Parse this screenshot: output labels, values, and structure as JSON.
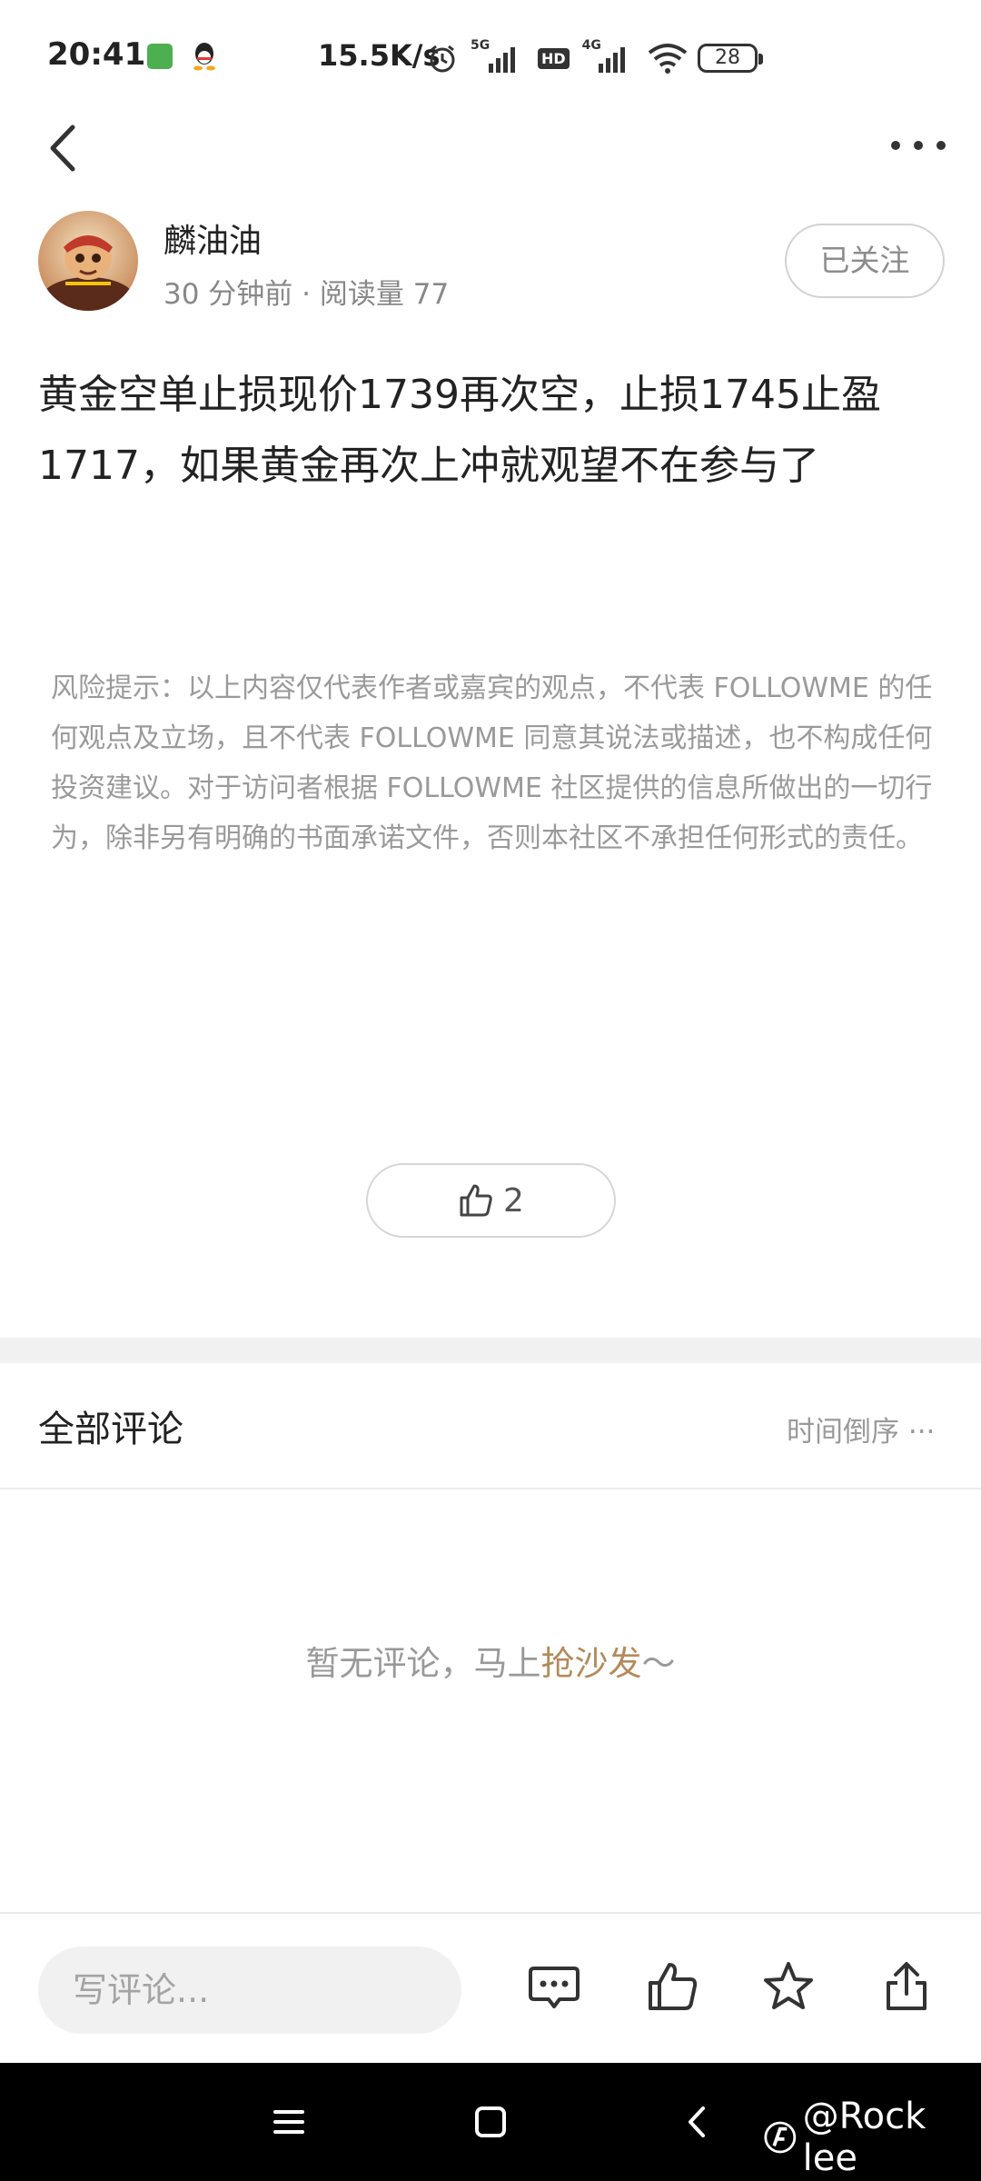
{
  "status_bar": {
    "time": "20:41",
    "net_speed": "15.5K/s",
    "sim1_tag": "5G",
    "hd_tag": "HD",
    "sim2_tag": "4G",
    "battery": "28"
  },
  "author": {
    "name": "麟油油",
    "meta": "30 分钟前 · 阅读量 77",
    "follow_label": "已关注"
  },
  "article": {
    "body": "黄金空单止损现价1739再次空，止损1745止盈1717，如果黄金再次上冲就观望不在参与了"
  },
  "disclaimer": "风险提示：以上内容仅代表作者或嘉宾的观点，不代表 FOLLOWME 的任何观点及立场，且不代表 FOLLOWME 同意其说法或描述，也不构成任何投资建议。对于访问者根据 FOLLOWME 社区提供的信息所做出的一切行为，除非另有明确的书面承诺文件，否则本社区不承担任何形式的责任。",
  "like": {
    "count": "2"
  },
  "comments": {
    "title": "全部评论",
    "sort_label": "时间倒序 ···",
    "empty_prefix": "暂无评论，马上",
    "empty_link": "抢沙发",
    "empty_suffix": "～"
  },
  "bottom_bar": {
    "input_placeholder": "写评论..."
  },
  "watermark": {
    "text": "@Rock lee"
  },
  "colors": {
    "accent_link": "#b48a5a",
    "separator": "#f1f1f1"
  }
}
